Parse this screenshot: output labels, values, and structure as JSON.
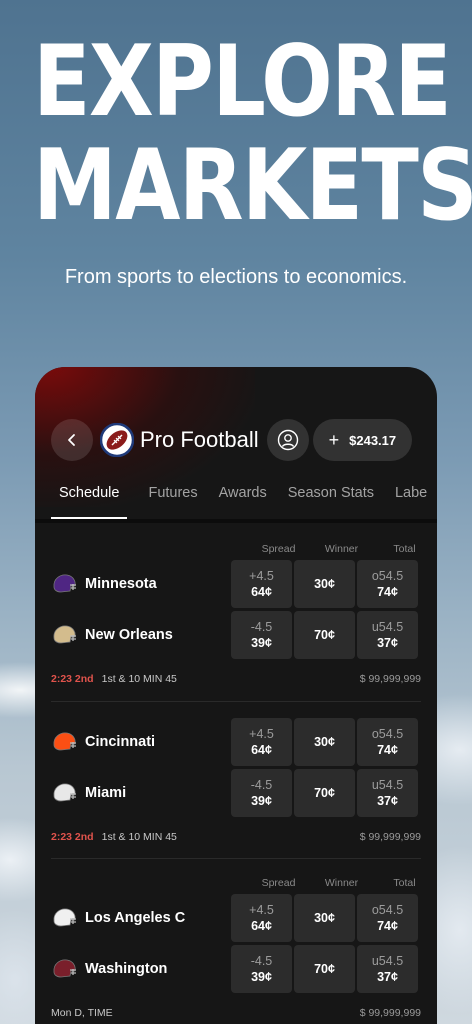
{
  "hero": {
    "headline_line1": "EXPLORE",
    "headline_line2": "MARKETS",
    "subline": "From sports to elections to economics."
  },
  "header": {
    "title": "Pro Football",
    "balance": "$243.17",
    "plus": "+"
  },
  "tabs": [
    "Schedule",
    "Futures",
    "Awards",
    "Season Stats",
    "Labe"
  ],
  "columns": {
    "spread": "Spread",
    "winner": "Winner",
    "total": "Total"
  },
  "games": [
    {
      "teams": [
        {
          "name": "Minnesota",
          "helmet_color": "#4f2683",
          "spread": "+4.5",
          "spread_price": "64¢",
          "winner": "30¢",
          "total": "o54.5",
          "total_price": "74¢"
        },
        {
          "name": "New Orleans",
          "helmet_color": "#d3bc8d",
          "spread": "-4.5",
          "spread_price": "39¢",
          "winner": "70¢",
          "total": "u54.5",
          "total_price": "37¢"
        }
      ],
      "status_live": "2:23 2nd",
      "status_detail": "1st & 10   MIN 45",
      "volume": "$ 99,999,999"
    },
    {
      "teams": [
        {
          "name": "Cincinnati",
          "helmet_color": "#fb4f14",
          "spread": "+4.5",
          "spread_price": "64¢",
          "winner": "30¢",
          "total": "o54.5",
          "total_price": "74¢"
        },
        {
          "name": "Miami",
          "helmet_color": "#e8e8e8",
          "spread": "-4.5",
          "spread_price": "39¢",
          "winner": "70¢",
          "total": "u54.5",
          "total_price": "37¢"
        }
      ],
      "status_live": "2:23 2nd",
      "status_detail": "1st & 10   MIN 45",
      "volume": "$ 99,999,999"
    },
    {
      "teams": [
        {
          "name": "Los Angeles C",
          "helmet_color": "#f0f0f0",
          "spread": "+4.5",
          "spread_price": "64¢",
          "winner": "30¢",
          "total": "o54.5",
          "total_price": "74¢"
        },
        {
          "name": "Washington",
          "helmet_color": "#7a1f2b",
          "spread": "-4.5",
          "spread_price": "39¢",
          "winner": "70¢",
          "total": "u54.5",
          "total_price": "37¢"
        }
      ],
      "status_live": "",
      "status_detail": "Mon D, TIME",
      "volume": "$ 99,999,999"
    }
  ],
  "icons": {
    "back": "chevron-left-icon",
    "ball": "football-icon",
    "user": "user-icon"
  },
  "colors": {
    "live": "#e0534c",
    "card_bg": "#161616",
    "cell_bg": "#2c2c2c",
    "accent_glow": "#820a0a"
  }
}
